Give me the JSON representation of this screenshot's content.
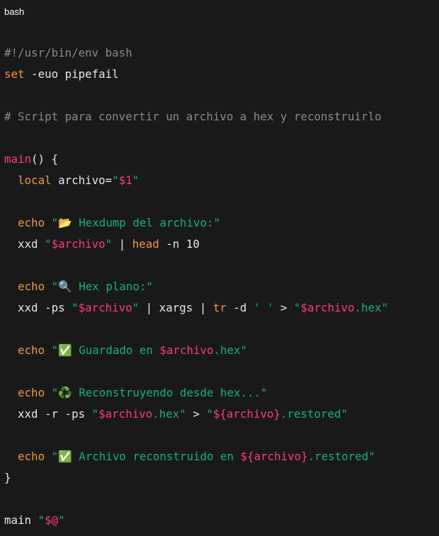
{
  "code_block": {
    "language": "bash",
    "colors": {
      "background": "#191919",
      "text": "#e8e8e8",
      "comment": "#8b8b8b",
      "keyword": "#f29a3a",
      "function_and_variable": "#ff3d73",
      "string": "#16b37d"
    },
    "lines": [
      [
        {
          "t": "#!/usr/bin/env bash",
          "c": "cm"
        }
      ],
      [
        {
          "t": "set",
          "c": "kw"
        },
        {
          "t": " -euo pipefail",
          "c": "pl"
        }
      ],
      [],
      [
        {
          "t": "# Script para convertir un archivo a hex y reconstruirlo",
          "c": "cm"
        }
      ],
      [],
      [
        {
          "t": "main",
          "c": "fn"
        },
        {
          "t": "() {",
          "c": "pl"
        }
      ],
      [
        {
          "t": "  ",
          "c": "pl"
        },
        {
          "t": "local",
          "c": "kw"
        },
        {
          "t": " archivo=",
          "c": "pl"
        },
        {
          "t": "\"",
          "c": "str"
        },
        {
          "t": "$1",
          "c": "var"
        },
        {
          "t": "\"",
          "c": "str"
        }
      ],
      [],
      [
        {
          "t": "  ",
          "c": "pl"
        },
        {
          "t": "echo",
          "c": "kw"
        },
        {
          "t": " \"📂 Hexdump del archivo:\"",
          "c": "str"
        }
      ],
      [
        {
          "t": "  xxd ",
          "c": "pl"
        },
        {
          "t": "\"",
          "c": "str"
        },
        {
          "t": "$archivo",
          "c": "var"
        },
        {
          "t": "\"",
          "c": "str"
        },
        {
          "t": " | ",
          "c": "pl"
        },
        {
          "t": "head",
          "c": "kw"
        },
        {
          "t": " -n 10",
          "c": "pl"
        }
      ],
      [],
      [
        {
          "t": "  ",
          "c": "pl"
        },
        {
          "t": "echo",
          "c": "kw"
        },
        {
          "t": " \"🔍 Hex plano:\"",
          "c": "str"
        }
      ],
      [
        {
          "t": "  xxd -ps ",
          "c": "pl"
        },
        {
          "t": "\"",
          "c": "str"
        },
        {
          "t": "$archivo",
          "c": "var"
        },
        {
          "t": "\"",
          "c": "str"
        },
        {
          "t": " | xargs | ",
          "c": "pl"
        },
        {
          "t": "tr",
          "c": "kw"
        },
        {
          "t": " -d ",
          "c": "pl"
        },
        {
          "t": "' '",
          "c": "str"
        },
        {
          "t": " > ",
          "c": "pl"
        },
        {
          "t": "\"",
          "c": "str"
        },
        {
          "t": "$archivo",
          "c": "var"
        },
        {
          "t": ".hex\"",
          "c": "str"
        }
      ],
      [],
      [
        {
          "t": "  ",
          "c": "pl"
        },
        {
          "t": "echo",
          "c": "kw"
        },
        {
          "t": " \"✅ Guardado en ",
          "c": "str"
        },
        {
          "t": "$archivo",
          "c": "var"
        },
        {
          "t": ".hex\"",
          "c": "str"
        }
      ],
      [],
      [
        {
          "t": "  ",
          "c": "pl"
        },
        {
          "t": "echo",
          "c": "kw"
        },
        {
          "t": " \"♻️ Reconstruyendo desde hex...\"",
          "c": "str"
        }
      ],
      [
        {
          "t": "  xxd -r -ps ",
          "c": "pl"
        },
        {
          "t": "\"",
          "c": "str"
        },
        {
          "t": "$archivo",
          "c": "var"
        },
        {
          "t": ".hex\"",
          "c": "str"
        },
        {
          "t": " > ",
          "c": "pl"
        },
        {
          "t": "\"",
          "c": "str"
        },
        {
          "t": "${archivo}",
          "c": "var"
        },
        {
          "t": ".restored\"",
          "c": "str"
        }
      ],
      [],
      [
        {
          "t": "  ",
          "c": "pl"
        },
        {
          "t": "echo",
          "c": "kw"
        },
        {
          "t": " \"✅ Archivo reconstruido en ",
          "c": "str"
        },
        {
          "t": "${archivo}",
          "c": "var"
        },
        {
          "t": ".restored\"",
          "c": "str"
        }
      ],
      [
        {
          "t": "}",
          "c": "pl"
        }
      ],
      [],
      [
        {
          "t": "main ",
          "c": "pl"
        },
        {
          "t": "\"",
          "c": "str"
        },
        {
          "t": "$@",
          "c": "var"
        },
        {
          "t": "\"",
          "c": "str"
        }
      ]
    ]
  }
}
